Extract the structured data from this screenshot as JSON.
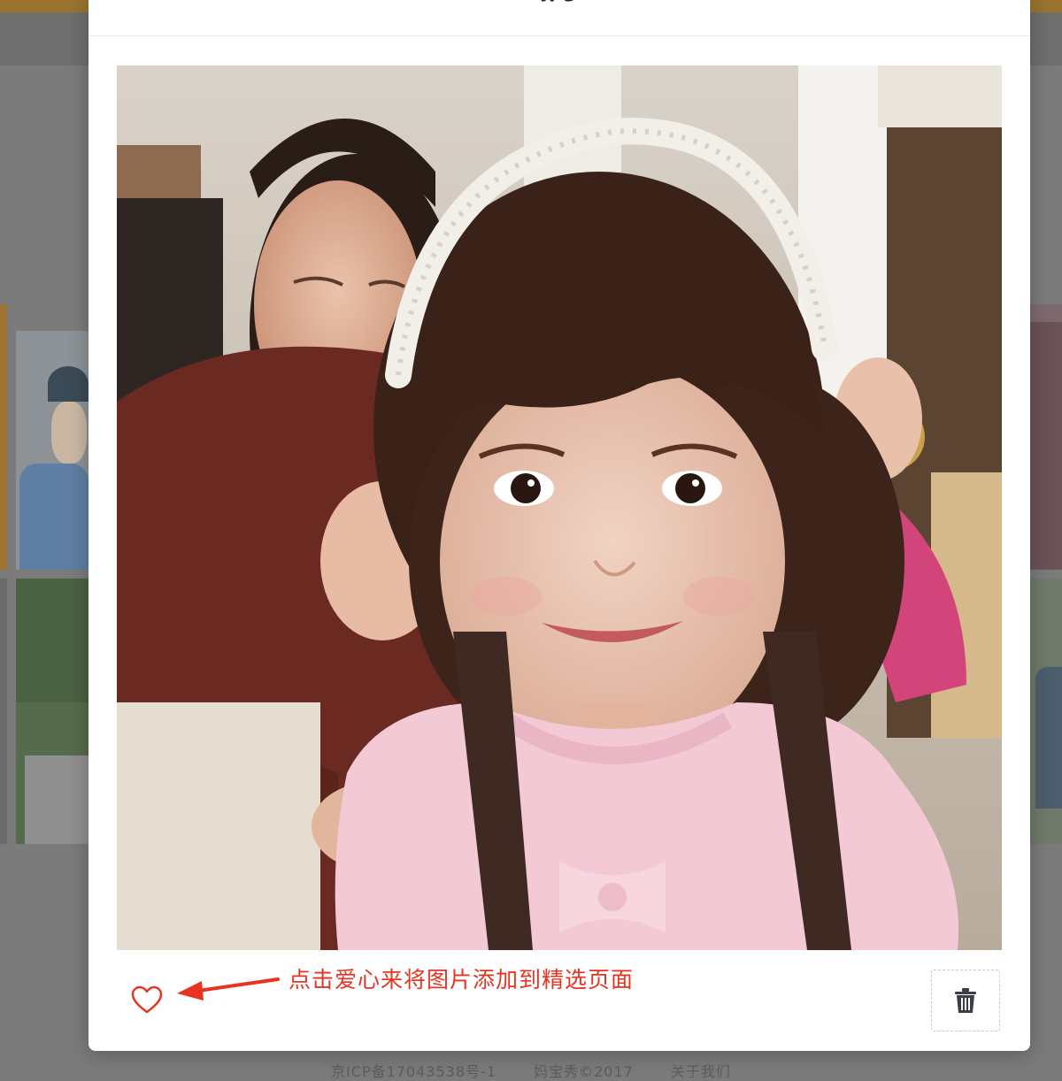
{
  "modal": {
    "title": "jpg",
    "photo_alt": "photo",
    "like_icon": "heart-outline-icon",
    "hint_text": "点击爱心来将图片添加到精选页面",
    "hint_color": "#e8331f",
    "delete_icon": "trash-icon"
  },
  "footer": {
    "icp": "京ICP备17043538号-1",
    "copyright": "妈宝秀©2017",
    "about": "关于我们"
  },
  "colors": {
    "overlay": "#7b7b7b",
    "accent_strip": "#9a7330"
  }
}
